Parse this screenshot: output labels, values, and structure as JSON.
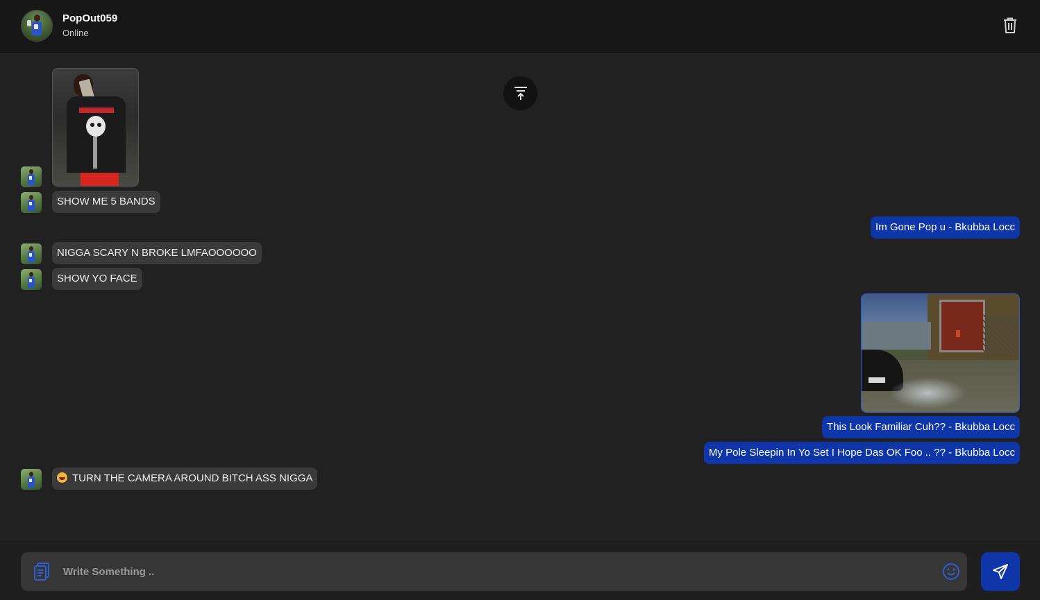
{
  "contact": {
    "name": "PopOut059",
    "status": "Online"
  },
  "icons": {
    "delete": "trash-icon",
    "scroll_top": "arrow-up-to-line-icon",
    "attach": "file-attach-icon",
    "emoji": "smiley-icon",
    "send": "paper-plane-icon"
  },
  "messages": [
    {
      "direction": "in",
      "type": "image",
      "image_desc": "photo"
    },
    {
      "direction": "in",
      "type": "text",
      "text": "SHOW ME 5 BANDS"
    },
    {
      "direction": "out",
      "type": "text",
      "text": "Im Gone Pop u - Bkubba Locc"
    },
    {
      "direction": "in",
      "type": "text",
      "text": "NIGGA SCARY N BROKE LMFAOOOOOO"
    },
    {
      "direction": "in",
      "type": "text",
      "text": "SHOW YO FACE"
    },
    {
      "direction": "out",
      "type": "image",
      "image_desc": "screenshot"
    },
    {
      "direction": "out",
      "type": "text",
      "text": "This Look Familiar Cuh?? - Bkubba Locc"
    },
    {
      "direction": "out",
      "type": "text",
      "text": "My Pole Sleepin In Yo Set I Hope Das OK Foo .. ?? - Bkubba Locc"
    },
    {
      "direction": "in",
      "type": "text",
      "emoji": "grinning-face",
      "text": "TURN THE CAMERA AROUND BITCH ASS NIGGA"
    }
  ],
  "composer": {
    "placeholder": "Write Something ..",
    "value": ""
  },
  "colors": {
    "background": "#212121",
    "header": "#171717",
    "incoming_bubble": "#3a3a3a",
    "outgoing_bubble": "#0e36a8",
    "input": "#363636"
  }
}
